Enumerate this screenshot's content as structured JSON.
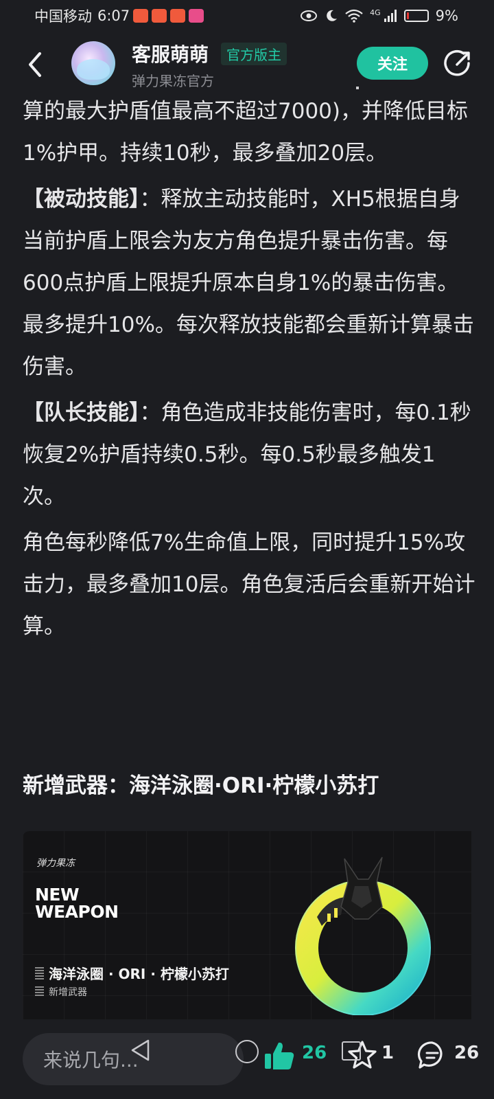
{
  "status_bar": {
    "carrier": "中国移动",
    "time": "6:07",
    "network": "4G",
    "battery": "9%",
    "battery_level": 0.09,
    "notif_colors": [
      "#f05a3c",
      "#f05a3c",
      "#f05a3c",
      "#e84d8a"
    ]
  },
  "header": {
    "username": "客服萌萌",
    "role_badge": "官方版主",
    "subtitle": "弹力果冻官方",
    "follow_label": "关注"
  },
  "article": {
    "para1": "算的最大护盾值最高不超过7000)，并降低目标1%护甲。持续10秒，最多叠加20层。",
    "para2_bold": "【被动技能】",
    "para2": "：释放主动技能时，XH5根据自身当前护盾上限会为友方角色提升暴击伤害。每600点护盾上限提升原本自身1%的暴击伤害。最多提升10%。每次释放技能都会重新计算暴击伤害。",
    "para3_bold": "【队长技能】",
    "para3": "：角色造成非技能伤害时，每0.1秒恢复2%护盾持续0.5秒。每0.5秒最多触发1次。",
    "para4": "角色每秒降低7%生命值上限，同时提升15%攻击力，最多叠加10层。角色复活后会重新开始计算。",
    "section_title": "新增武器：海洋泳圈·ORI·柠檬小苏打"
  },
  "banner": {
    "logo": "弹力果冻",
    "headline_line1": "NEW",
    "headline_line2": "WEAPON",
    "weapon_name": "海洋泳圈 · ORI · 柠檬小苏打",
    "tag": "新增武器"
  },
  "bottom_bar": {
    "comment_placeholder": "来说几句...",
    "like_count": "26",
    "star_count": "1",
    "comment_count": "26",
    "accent": "#21c6a4"
  }
}
